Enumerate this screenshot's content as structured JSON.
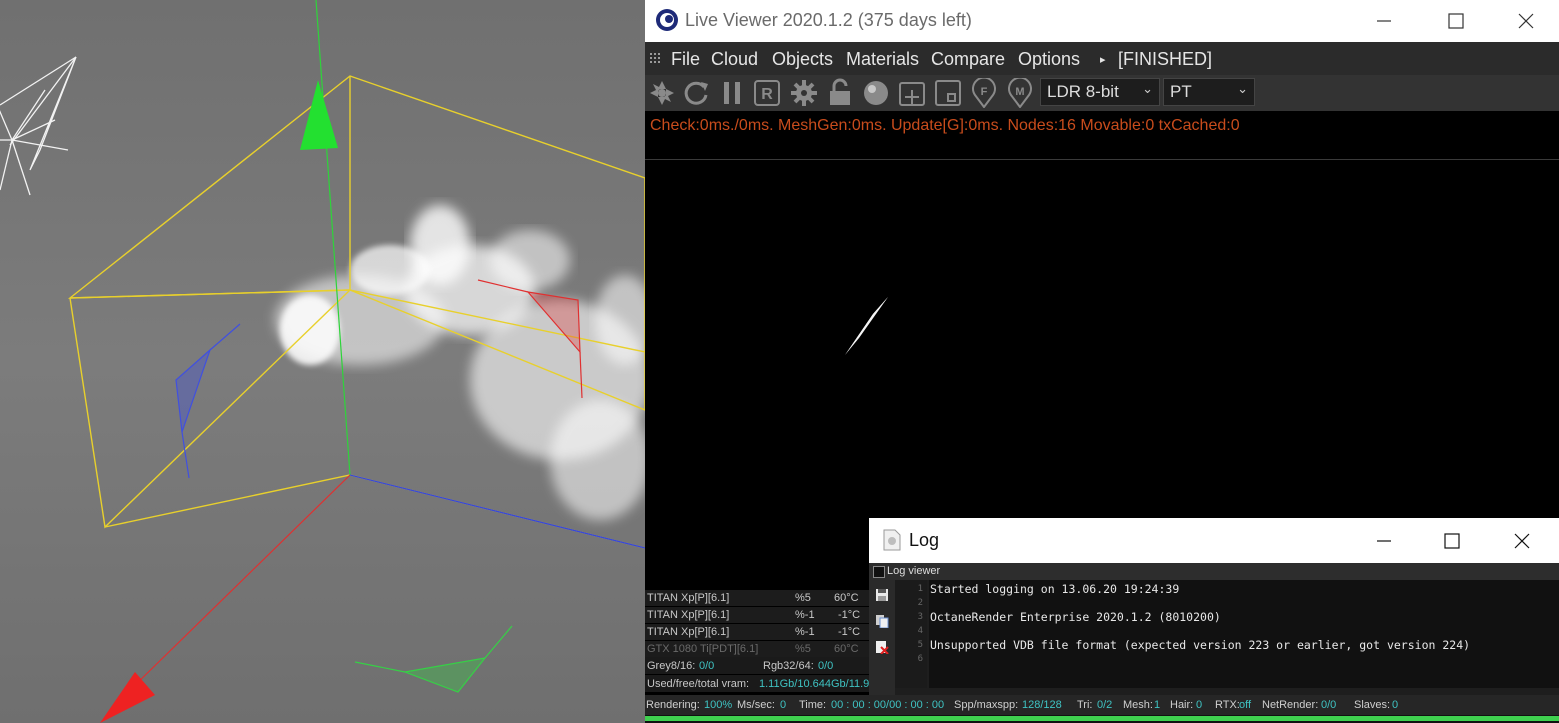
{
  "viewport": {
    "colors": {
      "bbox": "#e8d02c",
      "y_axis": "#2ed43a",
      "x_axis": "#e03030",
      "z_axis": "#3848d8"
    }
  },
  "live_viewer": {
    "title": "Live Viewer 2020.1.2 (375 days left)",
    "window_controls": {
      "minimize": "minimize",
      "maximize": "maximize",
      "close": "close"
    },
    "menu": {
      "file": "File",
      "cloud": "Cloud",
      "objects": "Objects",
      "materials": "Materials",
      "compare": "Compare",
      "options": "Options",
      "status": "[FINISHED]"
    },
    "toolbar": {
      "icons": [
        "aperture-icon",
        "refresh-icon",
        "pause-icon",
        "r-box-icon",
        "gear-icon",
        "lock-icon",
        "sphere-icon",
        "plus-box-icon",
        "region-box-icon",
        "f-pin-icon",
        "m-pin-icon"
      ],
      "color_depth": "LDR 8-bit",
      "kernel": "PT"
    },
    "stats_line": "Check:0ms./0ms. MeshGen:0ms. Update[G]:0ms. Nodes:16 Movable:0 txCached:0",
    "gpus": [
      {
        "name": "TITAN Xp[P][6.1]",
        "usage": "%5",
        "temp": "60°C",
        "enabled": true
      },
      {
        "name": "TITAN Xp[P][6.1]",
        "usage": "%-1",
        "temp": "-1°C",
        "enabled": true
      },
      {
        "name": "TITAN Xp[P][6.1]",
        "usage": "%-1",
        "temp": "-1°C",
        "enabled": true
      },
      {
        "name": "GTX 1080 Ti[PDT][6.1]",
        "usage": "%5",
        "temp": "60°C",
        "enabled": false
      }
    ],
    "memory": {
      "grey_label": "Grey8/16:",
      "grey_value": "0/0",
      "rgb_label": "Rgb32/64:",
      "rgb_value": "0/0",
      "vram_label": "Used/free/total vram:",
      "vram_value": "1.11Gb/10.644Gb/11.9"
    },
    "status_bar": {
      "rendering_label": "Rendering:",
      "rendering_value": "100%",
      "ms_label": "Ms/sec:",
      "ms_value": "0",
      "time_label": "Time:",
      "time_value": "00 : 00 : 00/00 : 00 : 00",
      "spp_label": "Spp/maxspp:",
      "spp_value": "128/128",
      "tri_label": "Tri:",
      "tri_value": "0/2",
      "mesh_label": "Mesh:",
      "mesh_value": "1",
      "hair_label": "Hair:",
      "hair_value": "0",
      "rtx_label": "RTX:",
      "rtx_value": "off",
      "net_label": "NetRender:",
      "net_value": "0/0",
      "slaves_label": "Slaves:",
      "slaves_value": "0"
    },
    "progress": 1.0
  },
  "log_window": {
    "title": "Log",
    "tab_label": "Log viewer",
    "line_numbers": [
      "1",
      "2",
      "3",
      "4",
      "5",
      "6"
    ],
    "lines": [
      "Started logging on 13.06.20 19:24:39",
      "",
      "OctaneRender Enterprise 2020.1.2 (8010200)",
      "",
      "Unsupported VDB file format (expected version 223 or earlier, got version 224)",
      ""
    ]
  }
}
